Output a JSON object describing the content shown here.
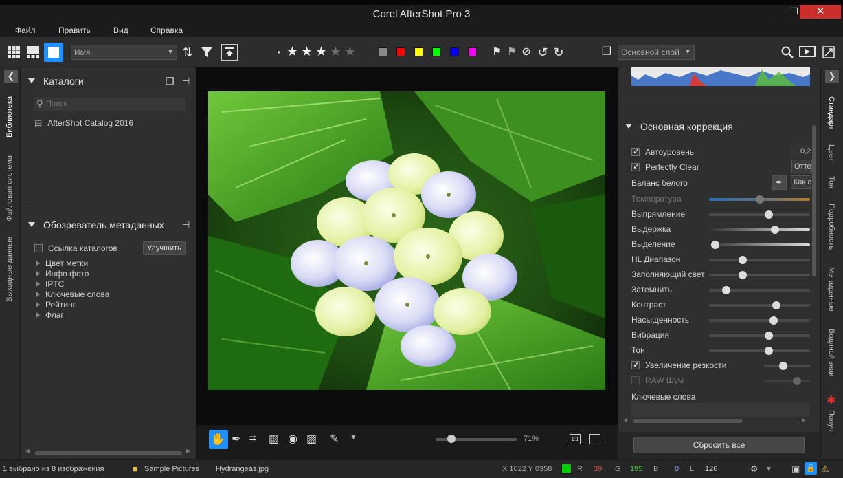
{
  "window": {
    "title": "Corel AfterShot Pro 3"
  },
  "menu": [
    "Файл",
    "Править",
    "Вид",
    "Справка"
  ],
  "toolbar": {
    "sort_value": "Имя",
    "layer_value": "Основной слой",
    "rating_filled": 3,
    "rating_total": 5,
    "color_labels": [
      "#8a8a8a",
      "#ff0000",
      "#ffff00",
      "#00ff00",
      "#0000ff",
      "#ff00ff"
    ]
  },
  "left_tabs": [
    "Библиотека",
    "Файловая система",
    "Выходные данные"
  ],
  "catalogs": {
    "title": "Каталоги",
    "search_placeholder": "Поиск",
    "items": [
      "AfterShot Catalog 2016"
    ]
  },
  "metadata": {
    "title": "Обозреватель метаданных",
    "catalog_links": "Ссылка каталогов",
    "improve_button": "Улучшить",
    "items": [
      "Цвет метки",
      "Инфо фото",
      "IPTC",
      "Ключевые слова",
      "Рейтинг",
      "Флаг"
    ]
  },
  "zoom": {
    "label": "71%",
    "value": 0.71
  },
  "basic": {
    "title": "Основная коррекция",
    "autolevel": "Автоуровень",
    "autolevel_value": "0,2",
    "perfectly_clear": "Perfectly Clear",
    "perfectly_clear_btn": "Отте",
    "white_balance": "Баланс белого",
    "white_balance_btn": "Как с",
    "sliders": [
      {
        "label": "Температура",
        "value": 0.5,
        "dim": true
      },
      {
        "label": "Выпрямление",
        "value": 0.6
      },
      {
        "label": "Выдержка",
        "value": 0.67
      },
      {
        "label": "Выделение",
        "value": 0.02
      },
      {
        "label": "HL Диапазон",
        "value": 0.32
      },
      {
        "label": "Заполняющий свет",
        "value": 0.32
      },
      {
        "label": "Затемнить",
        "value": 0.14
      },
      {
        "label": "Контраст",
        "value": 0.68
      },
      {
        "label": "Насыщенность",
        "value": 0.65
      },
      {
        "label": "Вибрация",
        "value": 0.6
      },
      {
        "label": "Тон",
        "value": 0.6
      }
    ],
    "sharpen": "Увеличение резкости",
    "raw_noise": "RAW Шум",
    "keywords": "Ключевые слова",
    "reset_button": "Сбросить все"
  },
  "right_tabs": [
    "Стандарт",
    "Цвет",
    "Тон",
    "Подробность",
    "Метаданные",
    "Водяной знак",
    "Получ"
  ],
  "status": {
    "selection": "1 выбрано из 8 изображения",
    "folder": "Sample Pictures",
    "file": "Hydrangeas.jpg",
    "coords": "X 1022  Y 0358",
    "r_label": "R",
    "r": "39",
    "g_label": "G",
    "g": "195",
    "b_label": "B",
    "b": "0",
    "l_label": "L",
    "l": "126",
    "pixel_color": "#00cc00"
  }
}
